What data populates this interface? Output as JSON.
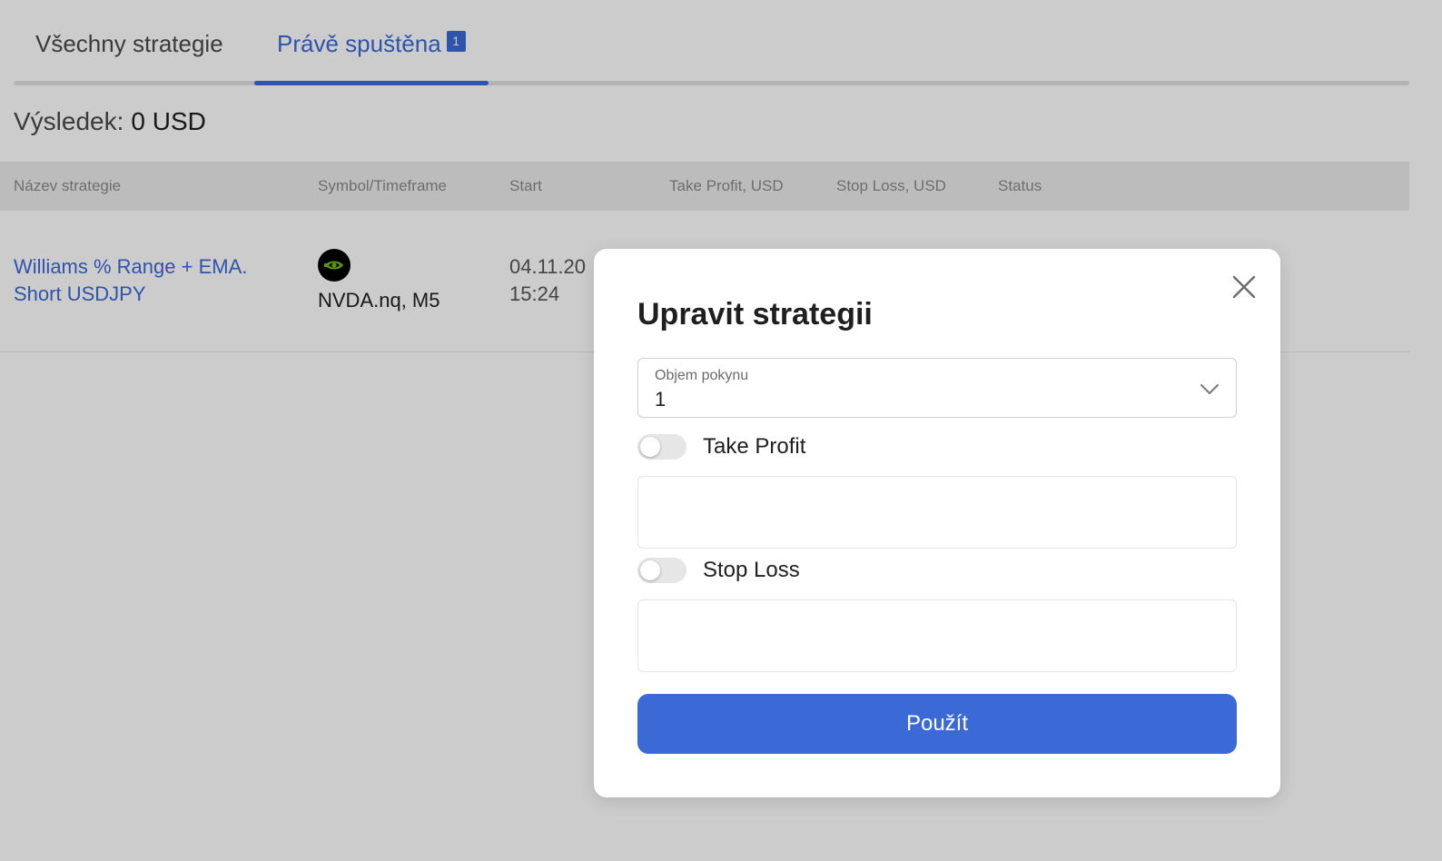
{
  "tabs": {
    "all_label": "Všechny strategie",
    "running_label": "Právě spuštěna",
    "running_count": "1"
  },
  "result": {
    "label": "Výsledek:",
    "value": "0 USD"
  },
  "table": {
    "headers": {
      "name": "Název strategie",
      "symbol": "Symbol/Timeframe",
      "start": "Start",
      "take_profit": "Take Profit, USD",
      "stop_loss": "Stop Loss, USD",
      "status": "Status"
    },
    "rows": [
      {
        "name": "Williams % Range + EMA. Short USDJPY",
        "symbol_icon": "nvidia-logo-icon",
        "symbol": "NVDA.nq, M5",
        "start_date": "04.11.20",
        "start_time": "15:24"
      }
    ]
  },
  "modal": {
    "title": "Upravit strategii",
    "volume_label": "Objem pokynu",
    "volume_value": "1",
    "take_profit_label": "Take Profit",
    "take_profit_value": "",
    "stop_loss_label": "Stop Loss",
    "stop_loss_value": "",
    "apply_label": "Použít"
  },
  "colors": {
    "accent": "#3b69d6",
    "nvidia_green": "#76b900"
  }
}
